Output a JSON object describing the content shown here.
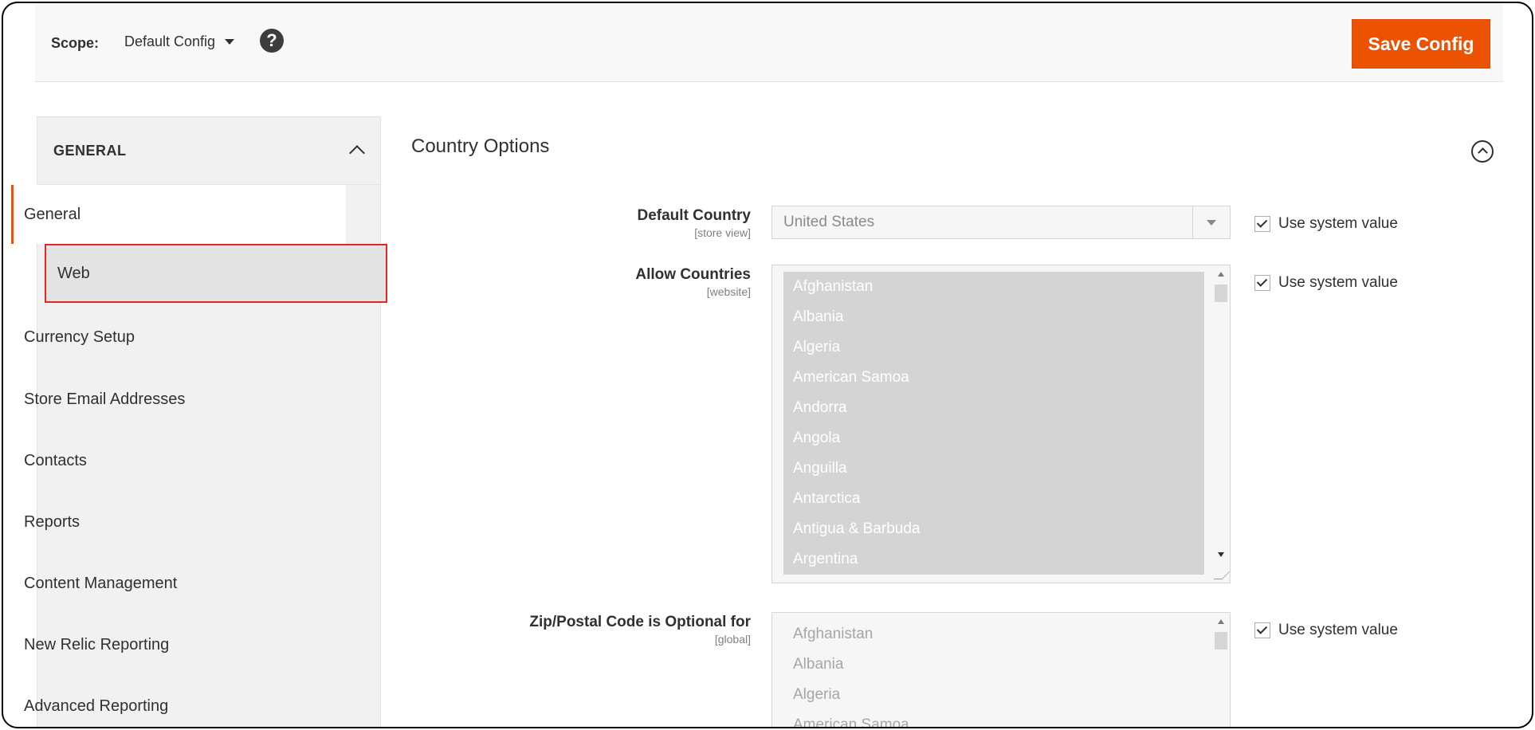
{
  "scope_bar": {
    "label": "Scope:",
    "selected": "Default Config",
    "save_label": "Save Config"
  },
  "sidebar": {
    "title": "GENERAL",
    "items": [
      {
        "label": "General"
      },
      {
        "label": "Web"
      },
      {
        "label": "Currency Setup"
      },
      {
        "label": "Store Email Addresses"
      },
      {
        "label": "Contacts"
      },
      {
        "label": "Reports"
      },
      {
        "label": "Content Management"
      },
      {
        "label": "New Relic Reporting"
      },
      {
        "label": "Advanced Reporting"
      }
    ]
  },
  "section": {
    "title": "Country Options",
    "fields": {
      "default_country": {
        "label": "Default Country",
        "scope": "[store view]",
        "value": "United States",
        "use_system": "Use system value"
      },
      "allow_countries": {
        "label": "Allow Countries",
        "scope": "[website]",
        "options": [
          "Afghanistan",
          "Albania",
          "Algeria",
          "American Samoa",
          "Andorra",
          "Angola",
          "Anguilla",
          "Antarctica",
          "Antigua & Barbuda",
          "Argentina"
        ],
        "use_system": "Use system value"
      },
      "zip_optional": {
        "label": "Zip/Postal Code is Optional for",
        "scope": "[global]",
        "options": [
          "Afghanistan",
          "Albania",
          "Algeria",
          "American Samoa"
        ],
        "use_system": "Use system value"
      }
    }
  },
  "colors": {
    "accent": "#eb5202",
    "highlight_outline": "#e22626"
  }
}
